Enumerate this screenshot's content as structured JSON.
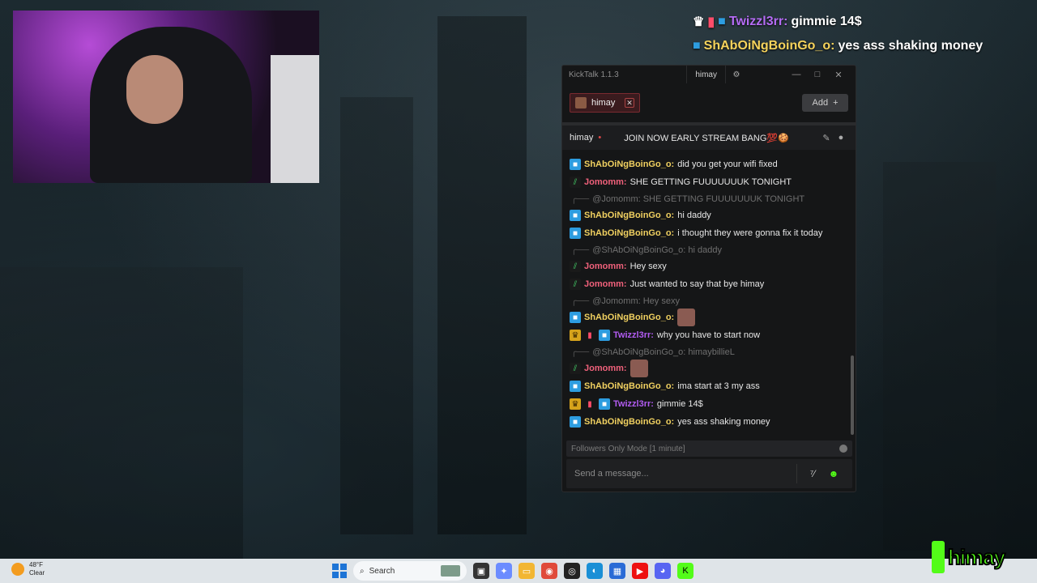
{
  "stream_chat_overlay": [
    {
      "user": "Twizzl3rr:",
      "text": "gimmie 14$",
      "badges": [
        "crown",
        "gift",
        "box"
      ]
    },
    {
      "user": "ShAbOiNgBoinGo_o:",
      "text": "yes ass shaking money",
      "badges": [
        "box"
      ]
    }
  ],
  "kicktalk": {
    "version": "KickTalk 1.1.3",
    "title_tab": "himay",
    "channel_tab": "himay",
    "add_label": "Add",
    "header": {
      "channel": "himay",
      "title": "JOIN NOW EARLY STREAM BANG💯🍪"
    },
    "messages": [
      {
        "type": "msg",
        "badges": [
          "box"
        ],
        "user": "ShAbOiNgBoinGo_o:",
        "color": "green",
        "text": "did you get your wifi fixed"
      },
      {
        "type": "msg",
        "badges": [
          "sub"
        ],
        "user": "Jomomm:",
        "color": "pink",
        "text": "SHE GETTING FUUUUUUUK TONIGHT"
      },
      {
        "type": "reply",
        "text": "@Jomomm: SHE GETTING FUUUUUUUK TONIGHT"
      },
      {
        "type": "msg",
        "badges": [
          "box"
        ],
        "user": "ShAbOiNgBoinGo_o:",
        "color": "green",
        "text": "hi daddy"
      },
      {
        "type": "msg",
        "badges": [
          "box"
        ],
        "user": "ShAbOiNgBoinGo_o:",
        "color": "green",
        "text": "i thought they were gonna fix it today"
      },
      {
        "type": "reply",
        "text": "@ShAbOiNgBoinGo_o: hi daddy"
      },
      {
        "type": "msg",
        "badges": [
          "sub"
        ],
        "user": "Jomomm:",
        "color": "pink",
        "text": "Hey sexy"
      },
      {
        "type": "msg",
        "badges": [
          "sub"
        ],
        "user": "Jomomm:",
        "color": "pink",
        "text": "Just wanted to say that bye himay"
      },
      {
        "type": "reply",
        "text": "@Jomomm: Hey sexy"
      },
      {
        "type": "msg",
        "badges": [
          "box"
        ],
        "user": "ShAbOiNgBoinGo_o:",
        "color": "green",
        "text": "",
        "emote": true
      },
      {
        "type": "msg",
        "badges": [
          "crown",
          "gift",
          "box"
        ],
        "user": "Twizzl3rr:",
        "color": "purple",
        "text": "why you have to start now"
      },
      {
        "type": "reply",
        "text": "@ShAbOiNgBoinGo_o: himaybillieL"
      },
      {
        "type": "msg",
        "badges": [
          "sub"
        ],
        "user": "Jomomm:",
        "color": "pink",
        "text": "",
        "emote": true
      },
      {
        "type": "msg",
        "badges": [
          "box"
        ],
        "user": "ShAbOiNgBoinGo_o:",
        "color": "green",
        "text": "ima start at 3 my ass"
      },
      {
        "type": "msg",
        "badges": [
          "crown",
          "gift",
          "box"
        ],
        "user": "Twizzl3rr:",
        "color": "purple",
        "text": "gimmie 14$"
      },
      {
        "type": "msg",
        "badges": [
          "box"
        ],
        "user": "ShAbOiNgBoinGo_o:",
        "color": "green",
        "text": "yes ass shaking money"
      }
    ],
    "followers_mode": "Followers Only Mode [1 minute]",
    "input_placeholder": "Send a message..."
  },
  "taskbar": {
    "weather_temp": "48°F",
    "weather_desc": "Clear",
    "search_label": "Search"
  },
  "watermark": "himay",
  "colors": {
    "kick_green": "#53fc18",
    "accent_red": "#7b2a30"
  }
}
